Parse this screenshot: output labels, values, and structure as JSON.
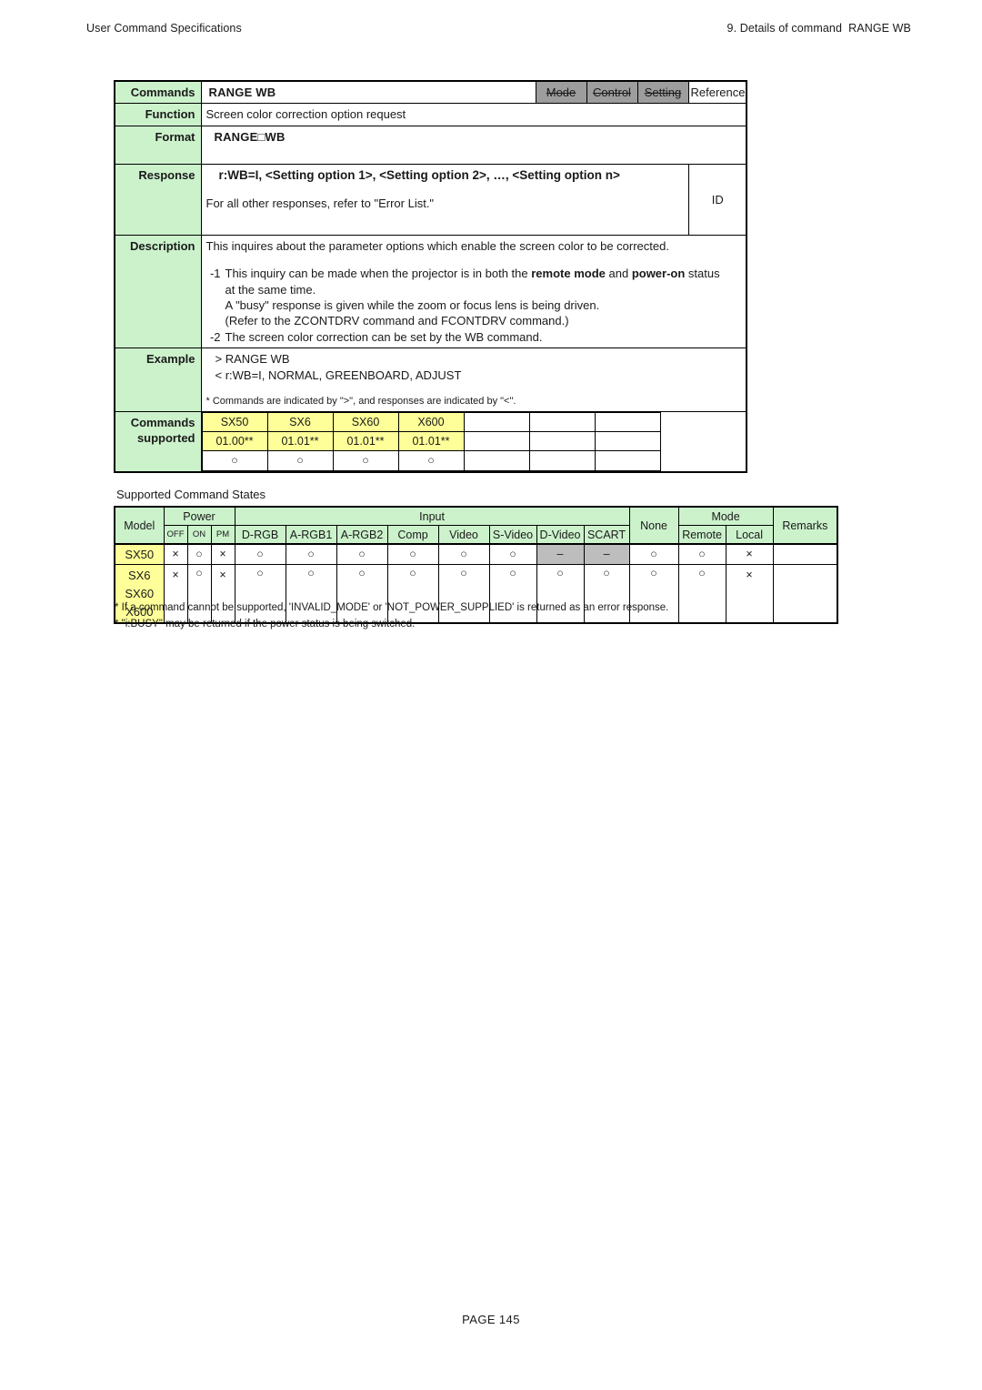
{
  "header": {
    "left": "User Command Specifications",
    "right": "9. Details of command  RANGE WB"
  },
  "command_table": {
    "labels": {
      "commands": "Commands",
      "function": "Function",
      "format": "Format",
      "response": "Response",
      "description": "Description",
      "example": "Example",
      "commands_supported_line1": "Commands",
      "commands_supported_line2": "supported"
    },
    "title": "RANGE WB",
    "flags": {
      "mode": "Mode",
      "control": "Control",
      "setting": "Setting",
      "reference": "Reference"
    },
    "function_text": "Screen color correction option request",
    "format_text": "RANGE□WB",
    "response_main": "r:WB=I, <Setting option 1>, <Setting option 2>, …, <Setting option n>",
    "response_other": "For all other responses, refer to \"Error List.\"",
    "response_id": "ID",
    "description_intro": "This inquires about the parameter options which enable the screen color to be corrected.",
    "description_items": [
      {
        "num": "-1",
        "lines": [
          {
            "text": "This inquiry can be made when the projector is in both the ",
            "bold1": "remote mode",
            "mid": " and ",
            "bold2": "power-on",
            "tail": " status"
          },
          {
            "text": "at the same time."
          },
          {
            "text": "A \"busy\" response is given while the zoom or focus lens is being driven."
          },
          {
            "text": "(Refer to the ZCONTDRV command and FCONTDRV command.)"
          }
        ]
      },
      {
        "num": "-2",
        "lines": [
          {
            "text": "The screen color correction can be set by the WB command."
          }
        ]
      }
    ],
    "example_lines": [
      "> RANGE WB",
      "< r:WB=I, NORMAL, GREENBOARD, ADJUST"
    ],
    "example_note": "* Commands are indicated by \">\", and responses are indicated by \"<\".",
    "supported": {
      "models": [
        "SX50",
        "SX6",
        "SX60",
        "X600",
        "",
        "",
        ""
      ],
      "versions": [
        "01.00**",
        "01.01**",
        "01.01**",
        "01.01**",
        "",
        "",
        ""
      ],
      "marks": [
        "○",
        "○",
        "○",
        "○",
        "",
        "",
        ""
      ]
    }
  },
  "states": {
    "title": "Supported Command States",
    "headers": {
      "model": "Model",
      "power": "Power",
      "power_sub": [
        "OFF",
        "ON",
        "PM"
      ],
      "input": "Input",
      "input_sub": [
        "D-RGB",
        "A-RGB1",
        "A-RGB2",
        "Comp",
        "Video",
        "S-Video",
        "D-Video",
        "SCART"
      ],
      "none": "None",
      "mode": "Mode",
      "mode_sub": [
        "Remote",
        "Local"
      ],
      "remarks": "Remarks"
    },
    "rows": [
      {
        "model": "SX50",
        "models_stacked": [
          "SX50"
        ],
        "power": [
          "×",
          "○",
          "×"
        ],
        "input": [
          "○",
          "○",
          "○",
          "○",
          "○",
          "○",
          "–",
          "–"
        ],
        "input_gray": [
          false,
          false,
          false,
          false,
          false,
          false,
          true,
          true
        ],
        "none": "○",
        "mode": [
          "○",
          "×"
        ],
        "remarks": ""
      },
      {
        "model": "SX6",
        "models_stacked": [
          "SX6",
          "SX60",
          "X600"
        ],
        "power": [
          "×",
          "○",
          "×"
        ],
        "input": [
          "○",
          "○",
          "○",
          "○",
          "○",
          "○",
          "○",
          "○"
        ],
        "input_gray": [
          false,
          false,
          false,
          false,
          false,
          false,
          false,
          false
        ],
        "none": "○",
        "mode": [
          "○",
          "×"
        ],
        "remarks": ""
      }
    ]
  },
  "footnotes": [
    "* If a command cannot be supported, 'INVALID_MODE' or 'NOT_POWER_SUPPLIED' is returned as an error response.",
    "* \"i:BUSY\" may be returned if the power status is being switched."
  ],
  "page_footer": "PAGE 145",
  "colors": {
    "label_green": "#ccf2cc",
    "model_yellow": "#ffff99",
    "flag_gray": "#9d9d9d",
    "cell_gray": "#bdbdbd"
  }
}
